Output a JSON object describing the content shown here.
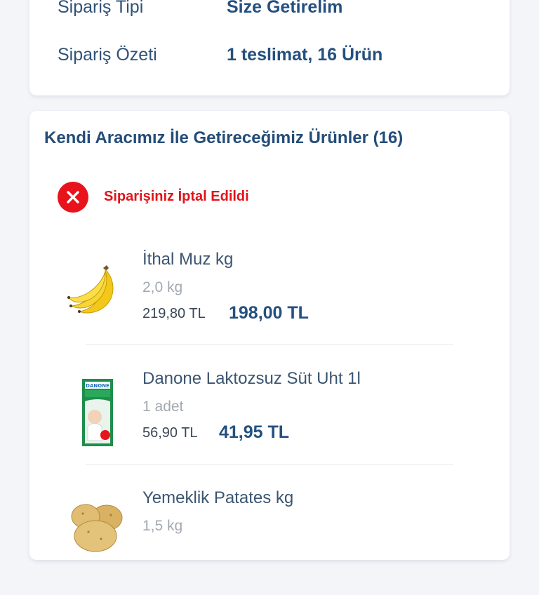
{
  "summary": {
    "order_type_label": "Sipariş Tipi",
    "order_type_value": "Size Getirelim",
    "order_summary_label": "Sipariş Özeti",
    "order_summary_value": "1 teslimat, 16 Ürün"
  },
  "products_section": {
    "title": "Kendi Aracımız İle Getireceğimiz Ürünler (16)",
    "status_text": "Siparişiniz İptal Edildi",
    "status_icon": "close-circle-icon",
    "status_color": "#e8131b",
    "items": [
      {
        "name": "İthal Muz kg",
        "quantity": "2,0 kg",
        "old_price": "219,80 TL",
        "price": "198,00 TL",
        "image": "banana-image"
      },
      {
        "name": "Danone Laktozsuz Süt Uht 1l",
        "quantity": "1 adet",
        "old_price": "56,90 TL",
        "price": "41,95 TL",
        "image": "milk-carton-image",
        "image_text": "DANONE"
      },
      {
        "name": "Yemeklik Patates kg",
        "quantity": "1,5 kg",
        "image": "potato-image"
      }
    ]
  },
  "colors": {
    "primary_text": "#24507f",
    "background": "#f3f5f9",
    "cancel_red": "#e0141a"
  }
}
